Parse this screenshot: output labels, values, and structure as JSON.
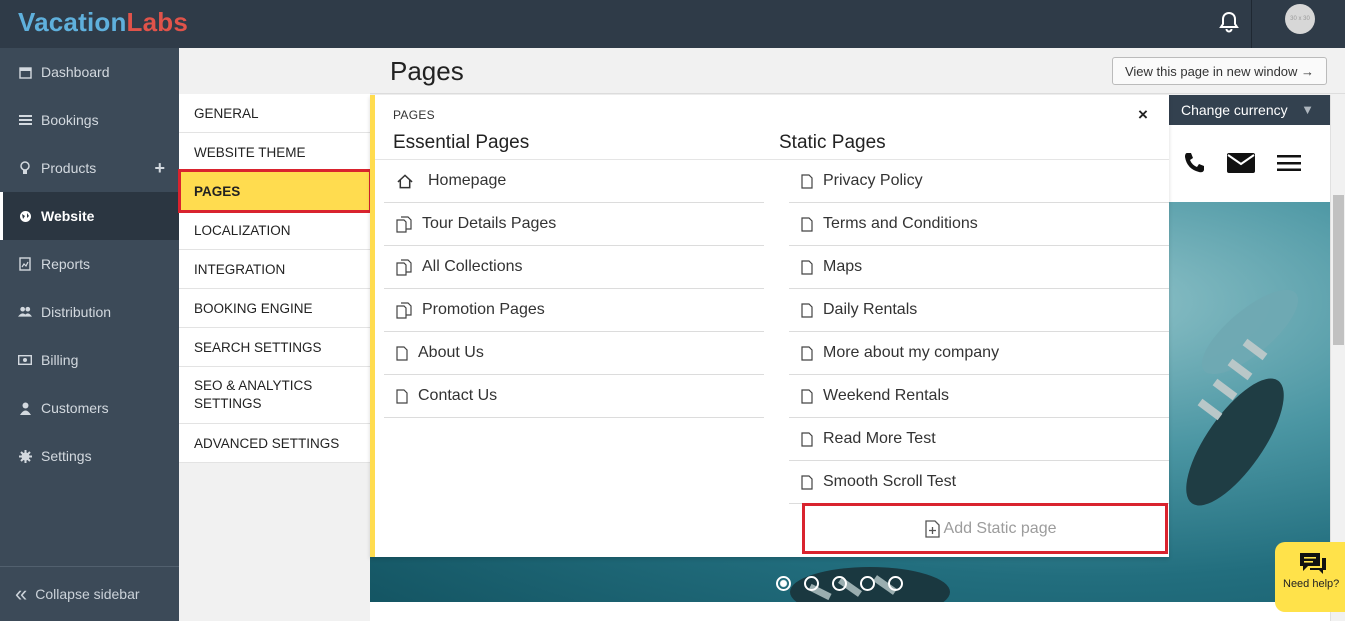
{
  "brand": {
    "part1": "Vacation",
    "part2": "Labs"
  },
  "topbar": {
    "avatar_text": "30 x 30"
  },
  "sidebar": {
    "items": [
      {
        "label": "Dashboard",
        "icon": "calendar-icon"
      },
      {
        "label": "Bookings",
        "icon": "list-icon"
      },
      {
        "label": "Products",
        "icon": "lightbulb-icon"
      },
      {
        "label": "Website",
        "icon": "globe-icon",
        "active": true
      },
      {
        "label": "Reports",
        "icon": "report-icon"
      },
      {
        "label": "Distribution",
        "icon": "users-icon"
      },
      {
        "label": "Billing",
        "icon": "money-icon"
      },
      {
        "label": "Customers",
        "icon": "user-icon"
      },
      {
        "label": "Settings",
        "icon": "gear-icon"
      }
    ],
    "products_add": "+",
    "collapse_label": "Collapse sidebar"
  },
  "settings_menu": {
    "items": [
      {
        "label": "GENERAL"
      },
      {
        "label": "WEBSITE THEME"
      },
      {
        "label": "PAGES",
        "active": true
      },
      {
        "label": "LOCALIZATION"
      },
      {
        "label": "INTEGRATION"
      },
      {
        "label": "BOOKING ENGINE"
      },
      {
        "label": "SEARCH SETTINGS"
      },
      {
        "label": "SEO & ANALYTICS SETTINGS"
      },
      {
        "label": "ADVANCED SETTINGS"
      }
    ]
  },
  "main": {
    "title": "Pages",
    "view_button": "View this page in new window →"
  },
  "panel": {
    "label": "PAGES",
    "close": "×",
    "essential_title": "Essential Pages",
    "static_title": "Static Pages",
    "essential_pages": [
      {
        "label": "Homepage",
        "icon": "home-icon"
      },
      {
        "label": "Tour Details Pages",
        "icon": "copy-icon"
      },
      {
        "label": "All Collections",
        "icon": "copy-icon"
      },
      {
        "label": "Promotion Pages",
        "icon": "copy-icon"
      },
      {
        "label": "About Us",
        "icon": "file-icon"
      },
      {
        "label": "Contact Us",
        "icon": "file-icon"
      }
    ],
    "static_pages": [
      {
        "label": "Privacy Policy"
      },
      {
        "label": "Terms and Conditions"
      },
      {
        "label": "Maps"
      },
      {
        "label": "Daily Rentals"
      },
      {
        "label": "More about my company"
      },
      {
        "label": "Weekend Rentals"
      },
      {
        "label": "Read More Test"
      },
      {
        "label": "Smooth Scroll Test"
      }
    ],
    "add_static": "Add Static page"
  },
  "preview": {
    "currency": "Change currency",
    "currency_arrow": "▼",
    "slider_dots": 5,
    "slider_active": 1
  },
  "help": {
    "label": "Need help?"
  },
  "colors": {
    "accent_yellow": "#ffdc4f",
    "highlight_red": "#d9232e",
    "sidebar_bg": "#3c4a58",
    "topbar_bg": "#2f3b48"
  }
}
